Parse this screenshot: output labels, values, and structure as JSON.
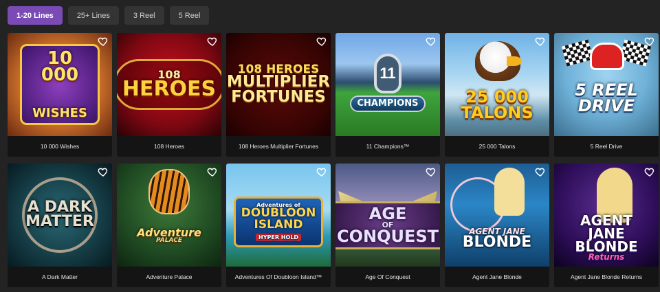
{
  "filters": [
    {
      "label": "1-20 Lines",
      "active": true
    },
    {
      "label": "25+ Lines",
      "active": false
    },
    {
      "label": "3 Reel",
      "active": false
    },
    {
      "label": "5 Reel",
      "active": false
    }
  ],
  "favorite_icon": "heart-outline-icon",
  "games": [
    {
      "title": "10 000 Wishes",
      "logo_line1": "10 000",
      "logo_line2": "Wishes"
    },
    {
      "title": "108 Heroes",
      "logo_line1": "108",
      "logo_line2": "Heroes"
    },
    {
      "title": "108 Heroes Multiplier Fortunes",
      "logo_line1": "108 Heroes",
      "logo_line2": "Multiplier",
      "logo_line3": "Fortunes"
    },
    {
      "title": "11 Champions™",
      "logo_line1": "11",
      "logo_line2": "Champions"
    },
    {
      "title": "25 000 Talons",
      "logo_line1": "25 000",
      "logo_line2": "Talons"
    },
    {
      "title": "5 Reel Drive",
      "logo_line1": "5 Reel",
      "logo_line2": "Drive"
    },
    {
      "title": "A Dark Matter",
      "logo_line1": "A Dark",
      "logo_line2": "Matter"
    },
    {
      "title": "Adventure Palace",
      "logo_line1": "Adventure",
      "logo_line2": "Palace"
    },
    {
      "title": "Adventures Of Doubloon Island™",
      "logo_line1": "Adventures of",
      "logo_line2": "Doubloon",
      "logo_line3": "Island",
      "logo_badge": "Hyper Hold"
    },
    {
      "title": "Age Of Conquest",
      "logo_line1": "Age",
      "logo_line2": "of",
      "logo_line3": "Conquest"
    },
    {
      "title": "Agent Jane Blonde",
      "logo_line1": "Agent Jane",
      "logo_line2": "Blonde"
    },
    {
      "title": "Agent Jane Blonde Returns",
      "logo_line1": "Agent",
      "logo_line2": "Jane Blonde",
      "logo_line3": "Returns"
    }
  ]
}
